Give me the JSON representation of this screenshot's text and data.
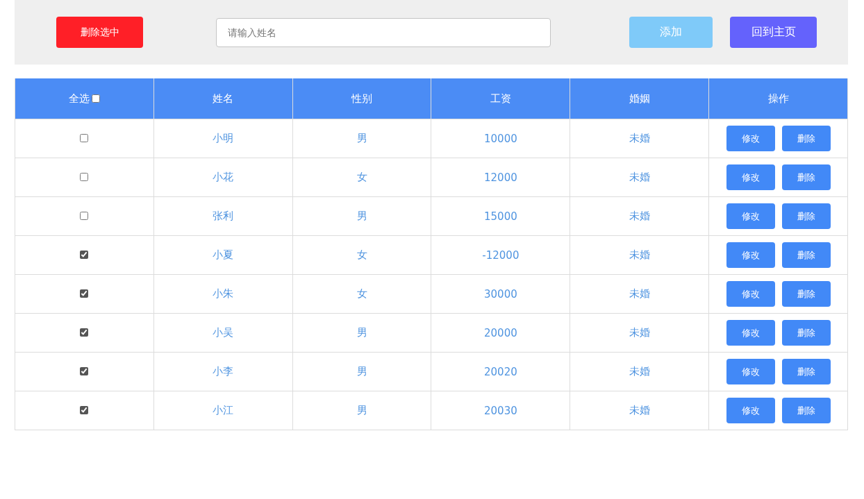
{
  "toolbar": {
    "delete_selected_button": "删除选中",
    "search": {
      "placeholder": "请输入姓名"
    },
    "add_button": "添加",
    "home_button": "回到主页"
  },
  "table": {
    "columns": [
      "全选",
      "姓名",
      "性别",
      "工资",
      "婚姻",
      "操作"
    ],
    "select_all_checked": false,
    "rows": [
      {
        "checked": false,
        "name": "小明",
        "gender": "男",
        "salary": "10000",
        "marital": "未婚",
        "actions": [
          "修改",
          "删除"
        ]
      },
      {
        "checked": false,
        "name": "小花",
        "gender": "女",
        "salary": "12000",
        "marital": "未婚",
        "actions": [
          "修改",
          "删除"
        ]
      },
      {
        "checked": false,
        "name": "张利",
        "gender": "男",
        "salary": "15000",
        "marital": "未婚",
        "actions": [
          "修改",
          "删除"
        ]
      },
      {
        "checked": true,
        "name": "小夏",
        "gender": "女",
        "salary": "-12000",
        "marital": "未婚",
        "actions": [
          "修改",
          "删除"
        ]
      },
      {
        "checked": true,
        "name": "小朱",
        "gender": "女",
        "salary": "30000",
        "marital": "未婚",
        "actions": [
          "修改",
          "删除"
        ]
      },
      {
        "checked": true,
        "name": "小吴",
        "gender": "男",
        "salary": "20000",
        "marital": "未婚",
        "actions": [
          "修改",
          "删除"
        ]
      },
      {
        "checked": true,
        "name": "小李",
        "gender": "男",
        "salary": "20020",
        "marital": "未婚",
        "actions": [
          "修改",
          "删除"
        ]
      },
      {
        "checked": true,
        "name": "小江",
        "gender": "男",
        "salary": "20030",
        "marital": "未婚",
        "actions": [
          "修改",
          "删除"
        ]
      }
    ]
  }
}
